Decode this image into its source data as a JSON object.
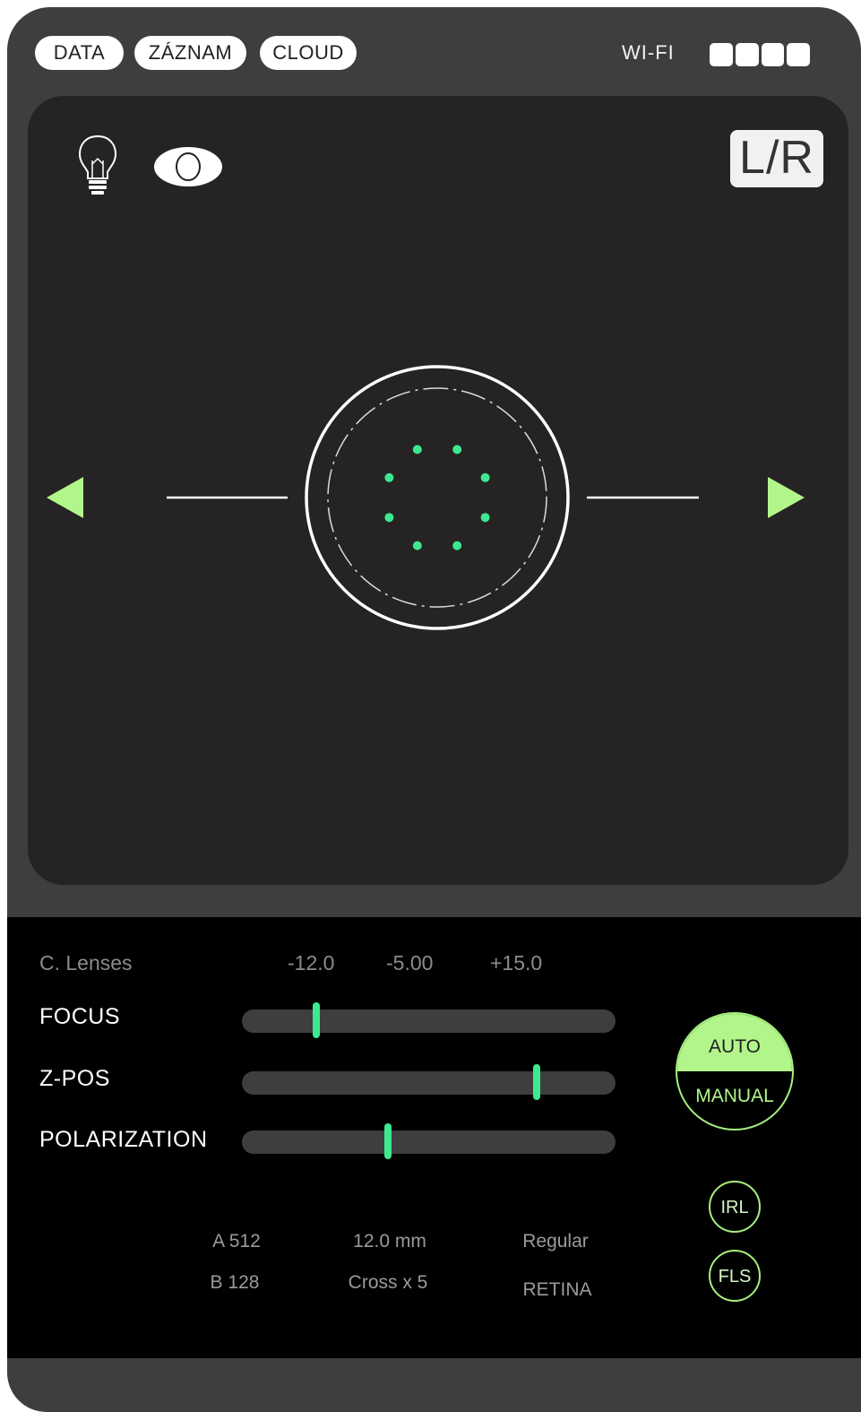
{
  "header": {
    "tabs": [
      {
        "label": "DATA"
      },
      {
        "label": "ZÁZNAM"
      },
      {
        "label": "CLOUD"
      }
    ],
    "wifi_label": "WI-FI",
    "signal_bars_filled": 4,
    "signal_bars_total": 4
  },
  "viewer": {
    "lr_label": "L/R",
    "icons": [
      "lightbulb-icon",
      "eye-icon",
      "left-arrow-icon",
      "right-arrow-icon"
    ],
    "target_dot_count": 8,
    "accent_color": "#3ee88f",
    "arrow_color": "#b2f58a"
  },
  "controls": {
    "lens_label": "C. Lenses",
    "lens_values": [
      "-12.0",
      "-5.00",
      "+15.0"
    ],
    "sliders": [
      {
        "label": "FOCUS",
        "value": 0.2
      },
      {
        "label": "Z-POS",
        "value": 0.79
      },
      {
        "label": "POLARIZATION",
        "value": 0.39
      }
    ],
    "mode": {
      "auto_label": "AUTO",
      "manual_label": "MANUAL"
    },
    "buttons": {
      "irl_label": "IRL",
      "fls_label": "FLS"
    },
    "info": {
      "a_value": "A 512",
      "b_value": "B 128",
      "distance": "12.0 mm",
      "pattern": "Cross x 5",
      "mode_text": "Regular",
      "target": "RETINA"
    }
  }
}
